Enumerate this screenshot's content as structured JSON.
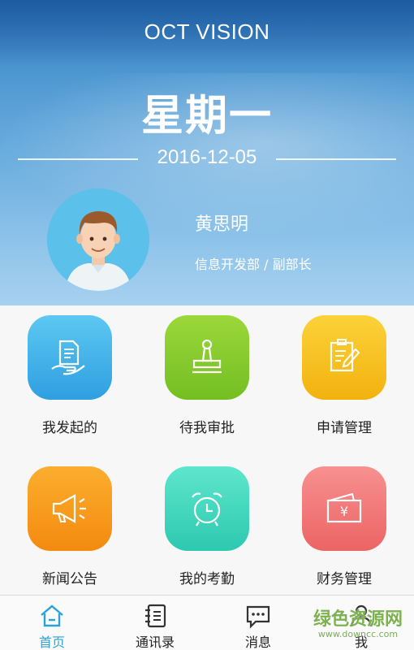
{
  "header": {
    "app_title": "OCT VISION",
    "weekday": "星期一",
    "date": "2016-12-05"
  },
  "user": {
    "name": "黄思明",
    "department": "信息开发部 / 副部长"
  },
  "tiles": [
    {
      "label": "我发起的",
      "icon": "document-hand-icon",
      "color": "#3aaee8"
    },
    {
      "label": "待我审批",
      "icon": "stamp-icon",
      "color": "#8ccc2e"
    },
    {
      "label": "申请管理",
      "icon": "edit-document-icon",
      "color": "#f6c11c"
    },
    {
      "label": "新闻公告",
      "icon": "megaphone-icon",
      "color": "#f79b1c"
    },
    {
      "label": "我的考勤",
      "icon": "alarm-clock-icon",
      "color": "#3fd6bf"
    },
    {
      "label": "财务管理",
      "icon": "wallet-icon",
      "color": "#f07575"
    }
  ],
  "tabbar": {
    "items": [
      {
        "label": "首页",
        "icon": "home-icon",
        "active": true
      },
      {
        "label": "通讯录",
        "icon": "contacts-icon",
        "active": false
      },
      {
        "label": "消息",
        "icon": "message-icon",
        "active": false
      },
      {
        "label": "我",
        "icon": "profile-icon",
        "active": false
      }
    ],
    "active_color": "#2aa3d6"
  },
  "watermark": {
    "text": "绿色资源网",
    "url_text": "www.downcc.com"
  }
}
